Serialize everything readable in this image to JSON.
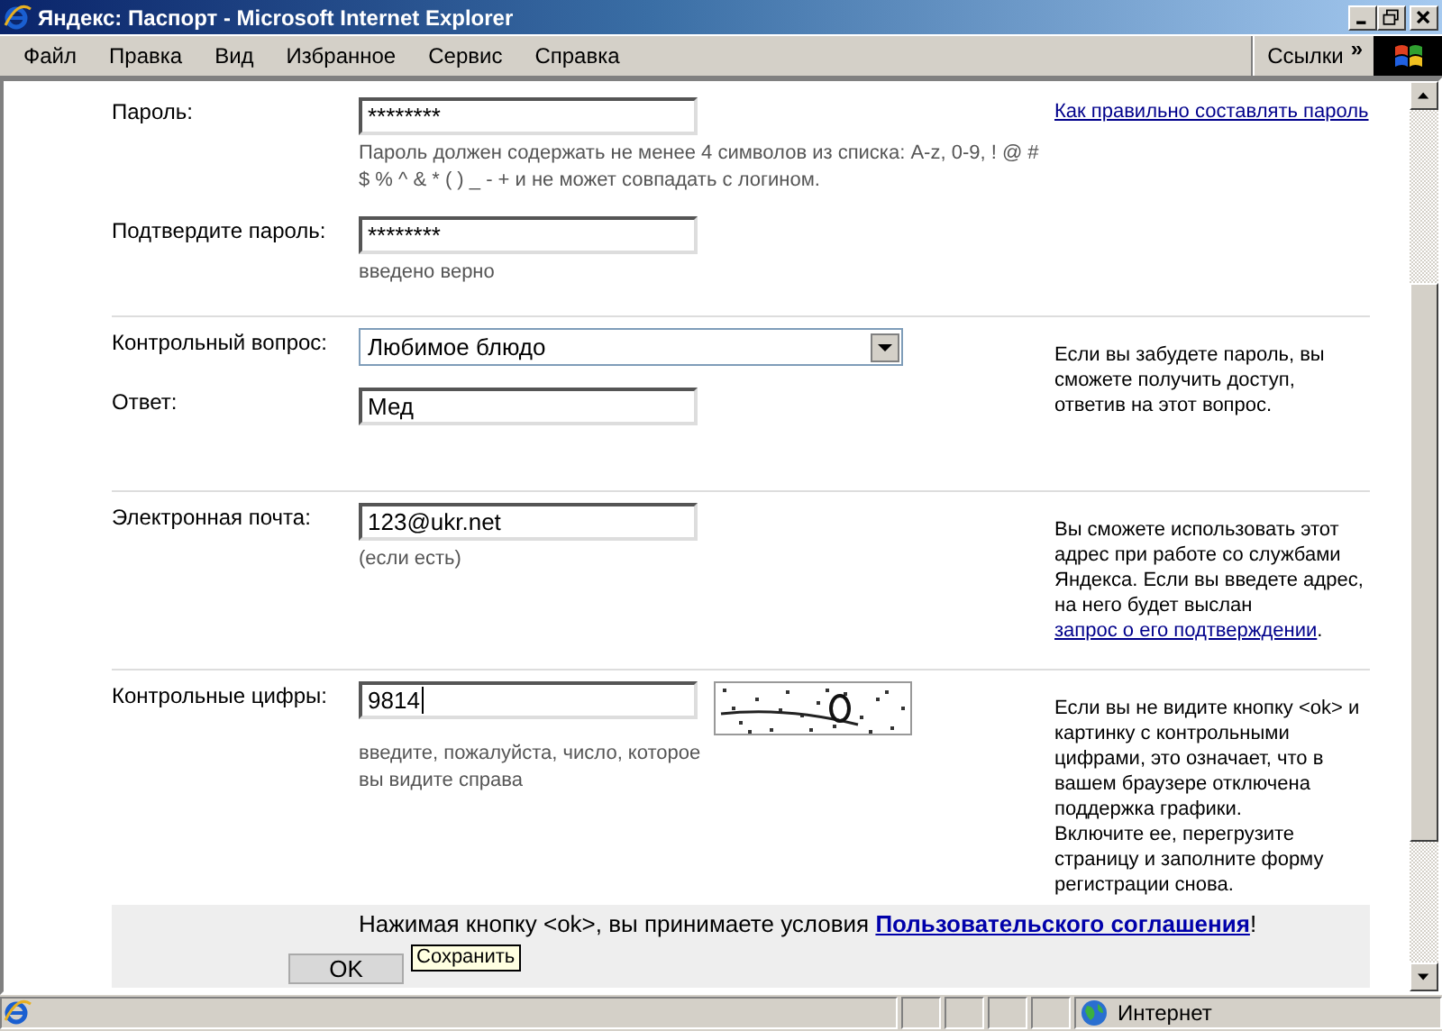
{
  "window": {
    "title": "Яндекс: Паспорт - Microsoft Internet Explorer"
  },
  "menu": [
    "Файл",
    "Правка",
    "Вид",
    "Избранное",
    "Сервис",
    "Справка"
  ],
  "links_bar": {
    "label": "Ссылки",
    "chevron": "»"
  },
  "sections": [
    {
      "rows": [
        {
          "label": "Пароль:",
          "kind": "text",
          "value": "********",
          "hint": "Пароль должен содержать не менее 4 символов из списка: A-z, 0-9, ! @ # $ % ^ & * ( ) _ - + и не может совпадать с логином."
        },
        {
          "label": "Подтвердите пароль:",
          "kind": "text",
          "value": "********",
          "hint": "введено верно"
        }
      ],
      "aside": [
        {
          "text": "Как правильно составлять пароль",
          "link": true
        }
      ]
    },
    {
      "rows": [
        {
          "label": "Контрольный вопрос:",
          "kind": "select",
          "value": "Любимое блюдо"
        },
        {
          "label": "Ответ:",
          "kind": "text",
          "value": "Мед"
        }
      ],
      "aside": [
        {
          "text": "Если вы забудете пароль, вы сможете получить доступ, ответив на этот вопрос.",
          "link": false
        }
      ]
    },
    {
      "rows": [
        {
          "label": "Электронная почта:",
          "kind": "text",
          "value": "123@ukr.net",
          "hint": "(если есть)"
        }
      ],
      "aside": [
        {
          "text": "Вы сможете использовать этот адрес при работе со службами Яндекса. Если вы введете адрес, на него будет выслан ",
          "link": false
        },
        {
          "text": "запрос о его подтверждении",
          "link": true
        },
        {
          "text": ".",
          "link": false
        }
      ]
    },
    {
      "rows": [
        {
          "label": "Контрольные цифры:",
          "kind": "captcha",
          "value": "9814",
          "focused": true,
          "hint": "введите, пожалуйста, число, которое вы видите справа"
        }
      ],
      "aside": [
        {
          "text": "Если вы не видите кнопку <ok> и картинку с контрольными цифрами, это означает, что в вашем браузере отключена поддержка графики.",
          "link": false
        },
        {
          "text": "Включите ее, перегрузите страницу и заполните форму регистрации снова.",
          "link": false,
          "break": true
        }
      ]
    }
  ],
  "footer": {
    "parts": [
      {
        "text": "Нажимая кнопку <ok>, вы принимаете условия ",
        "link": false
      },
      {
        "text": "Пользовательского соглашения",
        "link": true
      },
      {
        "text": "!",
        "link": false
      }
    ],
    "button": "OK",
    "tooltip": "Сохранить"
  },
  "status_bar": {
    "zone": "Интернет"
  }
}
